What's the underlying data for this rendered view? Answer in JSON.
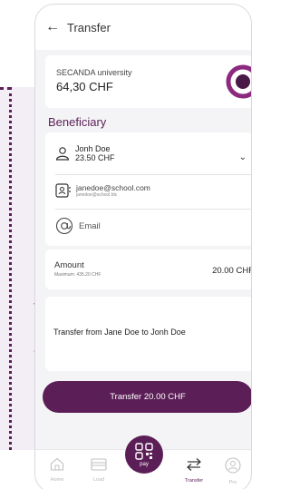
{
  "header": {
    "title": "Transfer",
    "back_icon": "back-arrow-icon"
  },
  "account": {
    "name": "SECANDA university",
    "balance": "64,30 CHF"
  },
  "beneficiary": {
    "section_title": "Beneficiary",
    "name": "Jonh Doe",
    "amount": "23.50 CHF",
    "email_main": "janedoe@school.com",
    "email_sub": "janedoe@school.btc",
    "email_label": "Email"
  },
  "amount": {
    "label": "Amount",
    "max": "Maximum: 435.20 CHF",
    "value": "20.00 CHF"
  },
  "message": {
    "text": "Transfer from Jane Doe to Jonh Doe"
  },
  "button": {
    "label": "Transfer 20.00 CHF"
  },
  "nav": {
    "home": "Home",
    "load": "Load",
    "pay": "pay",
    "transfer": "Transfer",
    "profile": "Pro"
  },
  "colors": {
    "accent": "#5b1e57",
    "background": "#f4f4f6"
  }
}
